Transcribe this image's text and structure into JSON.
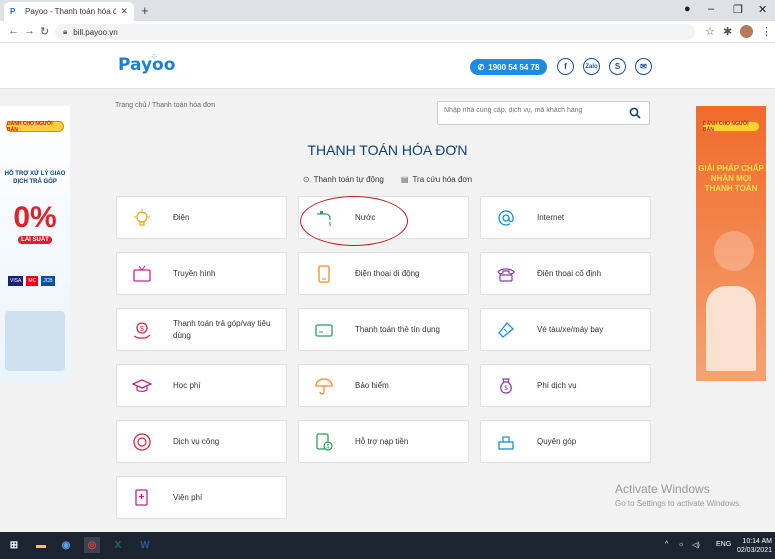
{
  "browser": {
    "tab_title": "Payoo - Thanh toán hóa đơn on...",
    "url": "bill.payoo.vn"
  },
  "header": {
    "logo": "Payoo",
    "hotline": "1900 54 54 78",
    "social": [
      "f",
      "Zalo",
      "S",
      "✉"
    ]
  },
  "breadcrumb": "Trang chủ  /  Thanh toán hóa đơn",
  "search": {
    "placeholder": "Nhập nhà cung cấp, dịch vụ, mã khách hàng"
  },
  "page_title": "THANH TOÁN HÓA ĐƠN",
  "tabs": [
    "Thanh toán tự động",
    "Tra cứu hóa đơn"
  ],
  "services": [
    {
      "label": "Điện",
      "icon": "bulb-icon",
      "color": "#e8a317"
    },
    {
      "label": "Nước",
      "icon": "faucet-icon",
      "color": "#2e9e5b"
    },
    {
      "label": "Internet",
      "icon": "at-icon",
      "color": "#1a8fd8"
    },
    {
      "label": "Truyền hình",
      "icon": "tv-icon",
      "color": "#c0258a"
    },
    {
      "label": "Điện thoại di động",
      "icon": "mobile-icon",
      "color": "#f08a24"
    },
    {
      "label": "Điện thoại cố định",
      "icon": "phone-icon",
      "color": "#8a3fa8"
    },
    {
      "label": "Thanh toán trả góp/vay tiêu dùng",
      "icon": "loan-icon",
      "color": "#d6263c"
    },
    {
      "label": "Thanh toán thẻ tín dụng",
      "icon": "card-icon",
      "color": "#2e9e5b"
    },
    {
      "label": "Vé tàu/xe/máy bay",
      "icon": "ticket-icon",
      "color": "#1a8fd8"
    },
    {
      "label": "Học phí",
      "icon": "graduation-icon",
      "color": "#c0258a"
    },
    {
      "label": "Bảo hiểm",
      "icon": "umbrella-icon",
      "color": "#f08a24"
    },
    {
      "label": "Phí dịch vụ",
      "icon": "fee-icon",
      "color": "#8a3fa8"
    },
    {
      "label": "Dịch vụ công",
      "icon": "public-service-icon",
      "color": "#d6263c"
    },
    {
      "label": "Hỗ trợ nạp tiền",
      "icon": "topup-icon",
      "color": "#2e9e5b"
    },
    {
      "label": "Quyên góp",
      "icon": "donate-icon",
      "color": "#1a8fd8"
    },
    {
      "label": "Viện phí",
      "icon": "hospital-icon",
      "color": "#c0258a"
    }
  ],
  "ad_left": {
    "tag": "DÀNH CHO NGƯỜI BÁN",
    "headline": "HỖ TRỢ XỬ LÝ GIAO DỊCH TRẢ GÓP",
    "big": "0%",
    "sub": "LÃI SUẤT",
    "cards": [
      "VISA",
      "MC",
      "JCB"
    ]
  },
  "ad_right": {
    "tag": "DÀNH CHO NGƯỜI BÁN",
    "headline": "GIẢI PHÁP CHẤP NHẬN MỌI THANH TOÁN"
  },
  "watermark": {
    "title": "Activate Windows",
    "subtitle": "Go to Settings to activate Windows."
  },
  "taskbar": {
    "lang": "ENG",
    "time": "10:14 AM",
    "date": "02/03/2021"
  }
}
